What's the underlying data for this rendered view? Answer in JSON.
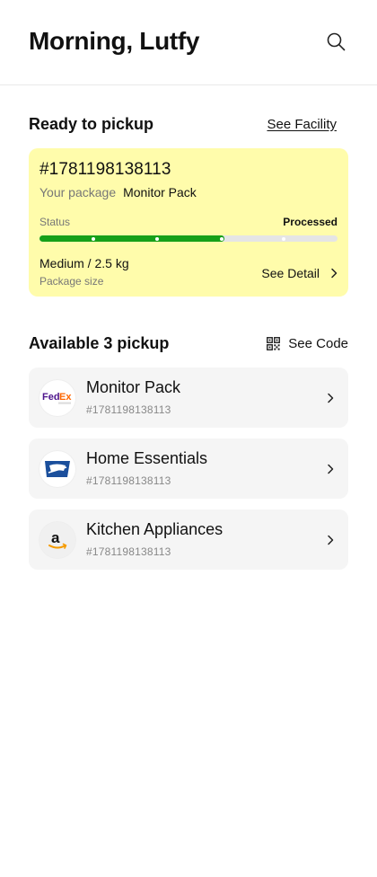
{
  "header": {
    "greeting": "Morning, Lutfy"
  },
  "ready": {
    "title": "Ready to pickup",
    "see_facility": "See Facility",
    "card": {
      "id": "#1781198138113",
      "package_label": "Your package",
      "package_name": "Monitor Pack",
      "status_label": "Status",
      "status_value": "Processed",
      "progress_fraction": 0.62,
      "size_value": "Medium / 2.5 kg",
      "size_label": "Package size",
      "see_detail": "See Detail",
      "background": "#fffcab",
      "progress_color": "#16a019"
    }
  },
  "available": {
    "title": "Available 3 pickup",
    "see_code": "See Code",
    "items": [
      {
        "name": "Monitor Pack",
        "id": "#1781198138113",
        "logo": "fedex-logo"
      },
      {
        "name": "Home Essentials",
        "id": "#1781198138113",
        "logo": "usps-logo"
      },
      {
        "name": "Kitchen Appliances",
        "id": "#1781198138113",
        "logo": "amazon-logo"
      }
    ]
  }
}
